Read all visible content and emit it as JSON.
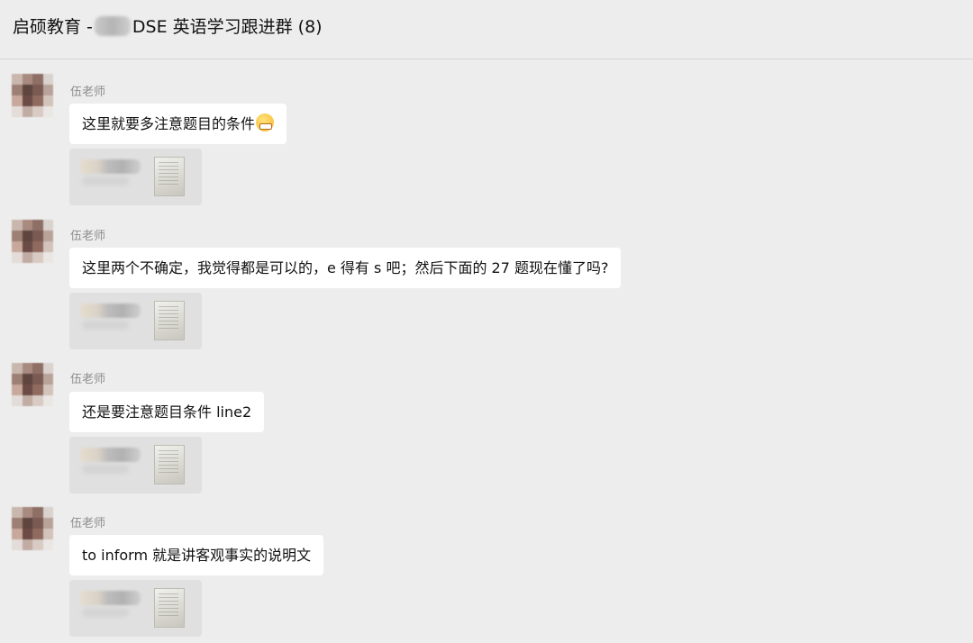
{
  "header": {
    "title_prefix": "启硕教育 -",
    "title_suffix": "DSE 英语学习跟进群 (8)"
  },
  "messages": [
    {
      "sender": "伍老师",
      "text": "这里就要多注意题目的条件",
      "emoji": "grimacing-face-icon"
    },
    {
      "sender": "伍老师",
      "text": "这里两个不确定，我觉得都是可以的，e 得有 s 吧；然后下面的 27 题现在懂了吗?"
    },
    {
      "sender": "伍老师",
      "text": "还是要注意题目条件 line2"
    },
    {
      "sender": "伍老师",
      "text": "to inform 就是讲客观事实的说明文"
    }
  ],
  "colors": {
    "background": "#ededed",
    "bubble": "#ffffff",
    "card": "#e0e0e0",
    "sender_name": "#8d8d8d"
  }
}
